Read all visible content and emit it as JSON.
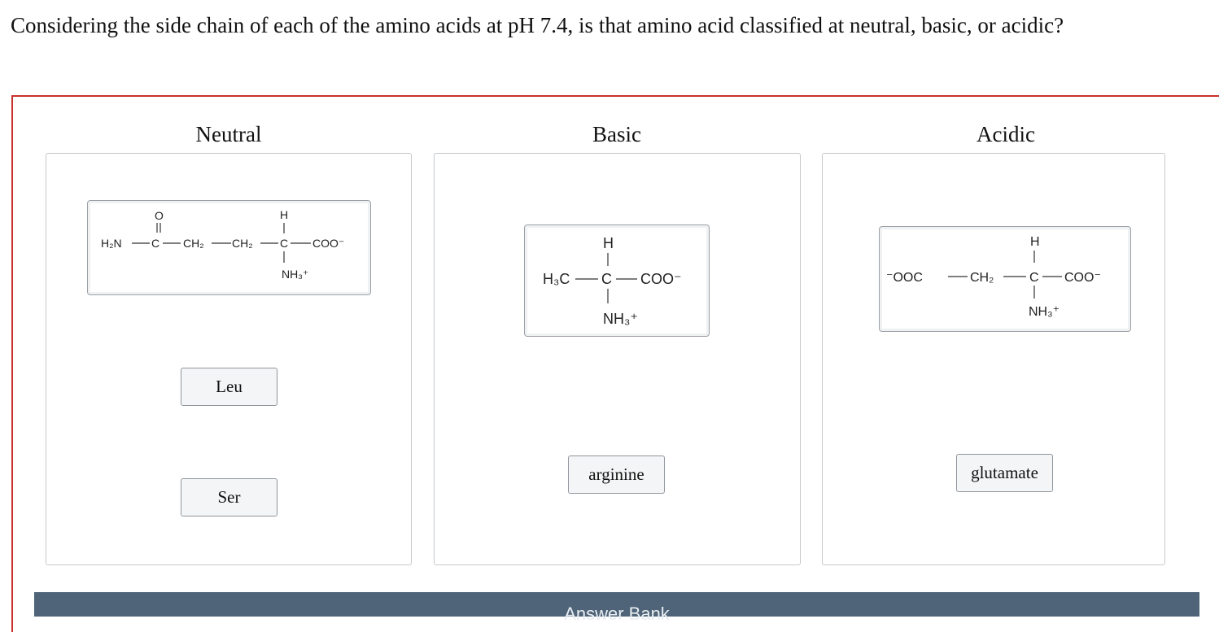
{
  "question": "Considering the side chain of each of the amino acids at pH 7.4, is that amino acid classified at neutral, basic, or acidic?",
  "categories": {
    "neutral": {
      "title": "Neutral",
      "chips": [
        "Leu",
        "Ser"
      ]
    },
    "basic": {
      "title": "Basic",
      "chips": [
        "arginine"
      ]
    },
    "acidic": {
      "title": "Acidic",
      "chips": [
        "glutamate"
      ]
    }
  },
  "structures": {
    "glutamine": {
      "left_group": "H₂N",
      "carbonyl_o": "O",
      "carbon": "C",
      "ch2a": "CH₂",
      "ch2b": "CH₂",
      "alpha_c": "C",
      "h": "H",
      "carboxylate": "COO⁻",
      "amine": "NH₃⁺"
    },
    "alanine": {
      "left_group": "H₃C",
      "alpha_c": "C",
      "h": "H",
      "carboxylate": "COO⁻",
      "amine": "NH₃⁺"
    },
    "aspartate": {
      "left_group": "⁻OOC",
      "ch2": "CH₂",
      "alpha_c": "C",
      "h": "H",
      "carboxylate": "COO⁻",
      "amine": "NH₃⁺"
    }
  },
  "answer_bank": {
    "title": "Answer Bank"
  },
  "colors": {
    "workspace_border": "#c8302c",
    "answer_bank_bg": "#4f6478"
  }
}
